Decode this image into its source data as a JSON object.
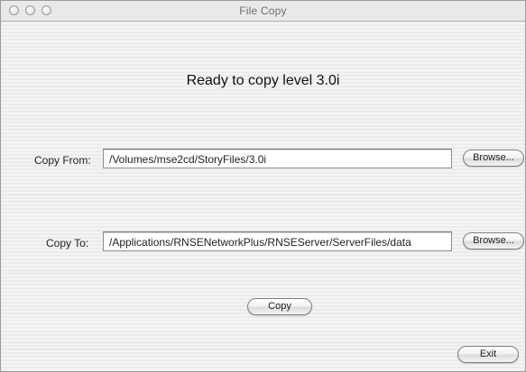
{
  "window": {
    "title": "File Copy"
  },
  "main": {
    "heading": "Ready to copy level 3.0i",
    "copy_from": {
      "label": "Copy From:",
      "value": "/Volumes/mse2cd/StoryFiles/3.0i",
      "browse_label": "Browse..."
    },
    "copy_to": {
      "label": "Copy To:",
      "value": "/Applications/RNSENetworkPlus/RNSEServer/ServerFiles/data",
      "browse_label": "Browse..."
    },
    "copy_label": "Copy",
    "exit_label": "Exit"
  }
}
